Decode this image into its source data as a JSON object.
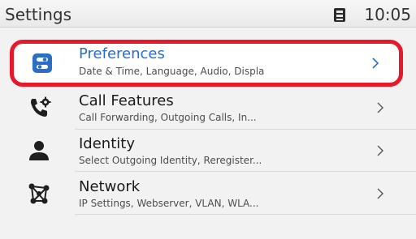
{
  "status_bar": {
    "title": "Settings",
    "time": "10:05",
    "battery_icon": "battery-icon"
  },
  "menu": {
    "items": [
      {
        "title": "Preferences",
        "subtitle": "Date & Time, Language, Audio, Displa",
        "icon": "preferences-toggle-icon",
        "selected": true
      },
      {
        "title": "Call Features",
        "subtitle": "Call Forwarding, Outgoing Calls, In...",
        "icon": "phone-gear-icon",
        "selected": false
      },
      {
        "title": "Identity",
        "subtitle": "Select Outgoing Identity, Reregister...",
        "icon": "person-icon",
        "selected": false
      },
      {
        "title": "Network",
        "subtitle": "IP Settings, Webserver, VLAN, WLA...",
        "icon": "network-icon",
        "selected": false
      }
    ]
  },
  "colors": {
    "highlight_border": "#e8182b",
    "selected_text": "#2a6ec6",
    "icon_dark": "#1f1f1f"
  }
}
